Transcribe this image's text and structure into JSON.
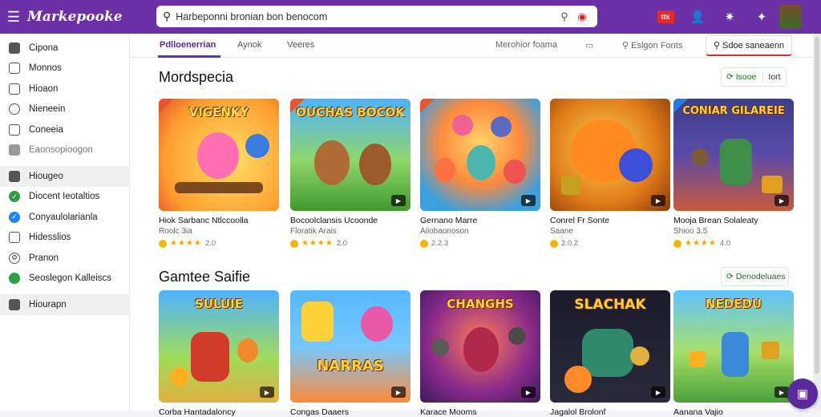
{
  "header": {
    "app_name": "Markepooke",
    "search_query": "Harbeponni bronian bon benocom",
    "badge": "ttk"
  },
  "sidebar": {
    "items": [
      {
        "label": "Cipona",
        "icon": "home-icon"
      },
      {
        "label": "Monnos",
        "icon": "chart-icon"
      },
      {
        "label": "Hioaon",
        "icon": "grid-icon"
      },
      {
        "label": "Nieneein",
        "icon": "circle-icon"
      },
      {
        "label": "Coneeia",
        "icon": "monitor-icon"
      },
      {
        "label": "Eaonsopioogon",
        "icon": "tag-icon"
      },
      {
        "label": "Hiougeo",
        "icon": "home-icon"
      },
      {
        "label": "Diocent Ieotaltios",
        "icon": "check-icon"
      },
      {
        "label": "Conyaulolarianla",
        "icon": "check-blue-icon"
      },
      {
        "label": "Hidesslios",
        "icon": "calendar-icon"
      },
      {
        "label": "Pranon",
        "icon": "gear-icon"
      },
      {
        "label": "Seoslegon Kalleiscs",
        "icon": "dot-icon"
      },
      {
        "label": "Hiourapn",
        "icon": "home-icon"
      }
    ]
  },
  "tabs": {
    "items": [
      "Pdlloenerrian",
      "Aynok",
      "Veeres"
    ],
    "right": [
      "Merohior foama",
      "Eslgon Fonts"
    ],
    "box_label": "Sdoe saneaenn"
  },
  "section1": {
    "title": "Mordspecia",
    "btn_label": "Isooe",
    "btn_extra": "Iort",
    "cards": [
      {
        "title_art": "VIGENKY",
        "name": "Hiok Sarbanc Ntlccoolla",
        "sub": "Roolc 3ia",
        "rating": "★★★★",
        "score": "2.0"
      },
      {
        "title_art": "OUCHAS BOCOK",
        "name": "Bocoolclansis Ucoonde",
        "sub": "Floratik Arais",
        "rating": "★★★★",
        "score": "2.0"
      },
      {
        "title_art": "",
        "name": "Gernano Marre",
        "sub": "Ailobaonoson",
        "rating": "",
        "score": "2.2.3"
      },
      {
        "title_art": "",
        "name": "Conrel Fr Sonte",
        "sub": "Saane",
        "rating": "",
        "score": "2.0.2"
      },
      {
        "title_art": "CONIAR GILAREIE",
        "name": "Mooja Brean Solaleaty",
        "sub": "Shioo 3.5",
        "rating": "★★★★",
        "score": "4.0"
      }
    ]
  },
  "section2": {
    "title": "Gamtee Saifie",
    "btn_label": "Denodeluaes",
    "cards": [
      {
        "title_art": "SULUIE",
        "name": "Corba Hantadaloncy"
      },
      {
        "title_art": "NARRAS",
        "name": "Congas Daaers"
      },
      {
        "title_art": "CHANGHS",
        "name": "Karace Mooms"
      },
      {
        "title_art": "SLACHAK",
        "name": "Jagalol Brolonf"
      },
      {
        "title_art": "NEDEDU",
        "name": "Aanana Vajio"
      }
    ]
  },
  "colors": {
    "brand": "#6b2fa6",
    "accent_green": "#1e6b2a"
  }
}
